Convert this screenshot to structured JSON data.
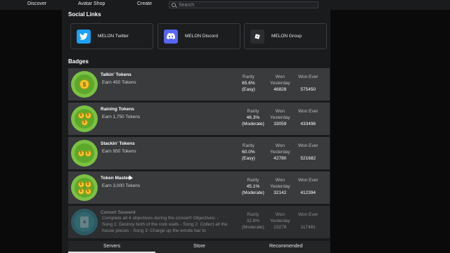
{
  "topbar": {
    "nav": [
      "Discover",
      "Avatar Shop",
      "Create"
    ],
    "search_placeholder": "Search"
  },
  "social": {
    "title": "Social Links",
    "links": [
      {
        "label": "MELON Twitter",
        "icon": "twitter-icon",
        "color": "#1da1f2"
      },
      {
        "label": "MELON Discord",
        "icon": "discord-icon",
        "color": "#5865f2"
      },
      {
        "label": "MELON Group",
        "icon": "roblox-group-icon",
        "color": "#2b2d30"
      }
    ]
  },
  "badges": {
    "title": "Badges",
    "headers": {
      "rarity": "Rarity",
      "won_yesterday_1": "Won",
      "won_yesterday_2": "Yesterday",
      "won_ever": "Won Ever"
    },
    "items": [
      {
        "name": "Talkin' Tokens",
        "desc": "Earn 450 Tokens",
        "rarity": "65.6%",
        "rarity_label": "(Easy)",
        "won_yesterday": "46828",
        "won_ever": "575450"
      },
      {
        "name": "Raining Tokens",
        "desc": "Earn 1,750 Tokens",
        "rarity": "46.3%",
        "rarity_label": "(Moderate)",
        "won_yesterday": "33059",
        "won_ever": "433496"
      },
      {
        "name": "Stackin' Tokens",
        "desc": "Earn 950 Tokens",
        "rarity": "60.0%",
        "rarity_label": "(Easy)",
        "won_yesterday": "42780",
        "won_ever": "521682"
      },
      {
        "name": "Token Master",
        "desc": "Earn 3,000 Tokens",
        "rarity": "45.1%",
        "rarity_label": "(Moderate)",
        "won_yesterday": "32142",
        "won_ever": "412394"
      },
      {
        "name": "Concert Souvenir",
        "desc": "Complete all 4 objectives during the concert! Objectives: - Song 1: Destroy both of the rock walls - Song 2: Collect all the house pieces - Song 3: Charge up the emote bar to",
        "rarity": "32.6%",
        "rarity_label": "(Moderate)",
        "won_yesterday": "23278",
        "won_ever": "117481"
      }
    ]
  },
  "tabs": [
    "Servers",
    "Store",
    "Recommended"
  ],
  "active_tab": "Servers"
}
